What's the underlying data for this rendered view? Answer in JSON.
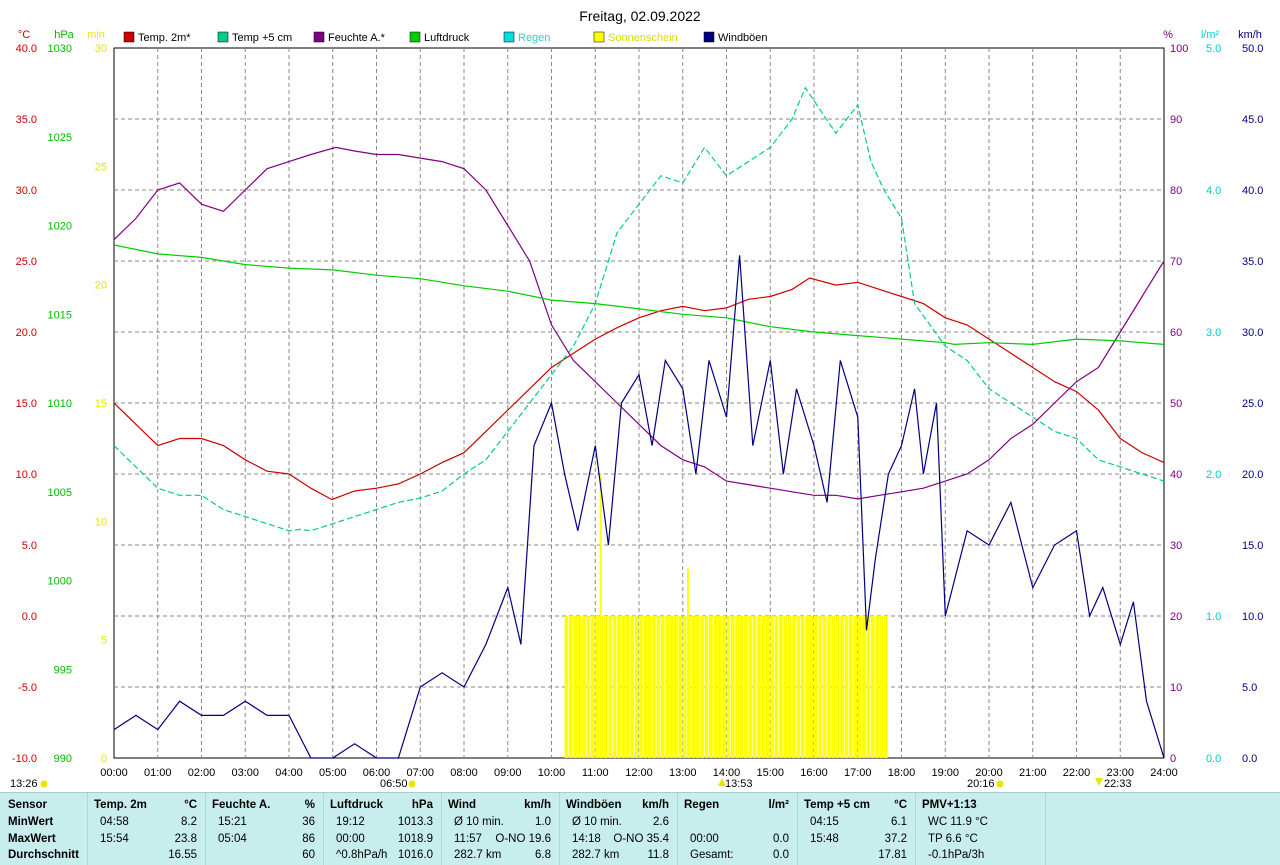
{
  "title": "Freitag, 02.09.2022",
  "axes": {
    "temp": {
      "unit": "°C",
      "color": "#cc0000",
      "ticks": [
        "40.0",
        "35.0",
        "30.0",
        "25.0",
        "20.0",
        "15.0",
        "10.0",
        "5.0",
        "0.0",
        "-5.0",
        "-10.0"
      ]
    },
    "pressure": {
      "unit": "hPa",
      "color": "#00bb00",
      "ticks": [
        "1030",
        "1025",
        "1020",
        "1015",
        "1010",
        "1005",
        "1000",
        "995",
        "990"
      ]
    },
    "minutes": {
      "unit": "min",
      "color": "#e6e600",
      "ticks": [
        "30",
        "25",
        "20",
        "15",
        "10",
        "5",
        "0"
      ]
    },
    "humidity": {
      "unit": "%",
      "color": "#800080",
      "ticks": [
        "100",
        "90",
        "80",
        "70",
        "60",
        "50",
        "40",
        "30",
        "20",
        "10",
        "0"
      ]
    },
    "rain": {
      "unit": "l/m²",
      "color": "#00cccc",
      "ticks": [
        "5.0",
        "4.0",
        "3.0",
        "2.0",
        "1.0",
        "0.0"
      ]
    },
    "wind": {
      "unit": "km/h",
      "color": "#000080",
      "ticks": [
        "50.0",
        "45.0",
        "40.0",
        "35.0",
        "30.0",
        "25.0",
        "20.0",
        "15.0",
        "10.0",
        "5.0",
        "0.0"
      ]
    }
  },
  "x_ticks": [
    "00:00",
    "01:00",
    "02:00",
    "03:00",
    "04:00",
    "05:00",
    "06:00",
    "07:00",
    "08:00",
    "09:00",
    "10:00",
    "11:00",
    "12:00",
    "13:00",
    "14:00",
    "15:00",
    "16:00",
    "17:00",
    "18:00",
    "19:00",
    "20:00",
    "21:00",
    "22:00",
    "23:00",
    "24:00"
  ],
  "legend": [
    {
      "label": "Temp. 2m*",
      "color": "#cc0000"
    },
    {
      "label": "Temp +5 cm",
      "color": "#00cc88"
    },
    {
      "label": "Feuchte A.*",
      "color": "#800080"
    },
    {
      "label": "Luftdruck",
      "color": "#00cc00"
    },
    {
      "label": "Regen",
      "color": "#00dddd"
    },
    {
      "label": "Sonnenschein",
      "color": "#ffff00"
    },
    {
      "label": "Windböen",
      "color": "#000080"
    }
  ],
  "markers": {
    "moonrise": "13:26",
    "sunrise": "06:50",
    "noon": "13:53",
    "sunset": "20:16",
    "moonset": "22:33"
  },
  "chart_data": {
    "type": "line",
    "x_unit": "hours",
    "series": [
      {
        "name": "Temp. 2m*",
        "axis": "temp",
        "color": "#cc0000",
        "points": [
          [
            0,
            15
          ],
          [
            0.5,
            13.5
          ],
          [
            1,
            12
          ],
          [
            1.5,
            12.5
          ],
          [
            2,
            12.5
          ],
          [
            2.5,
            12
          ],
          [
            3,
            11
          ],
          [
            3.5,
            10.2
          ],
          [
            4,
            10
          ],
          [
            4.5,
            9
          ],
          [
            4.98,
            8.2
          ],
          [
            5.5,
            8.8
          ],
          [
            6,
            9
          ],
          [
            6.5,
            9.3
          ],
          [
            7,
            10
          ],
          [
            7.5,
            10.8
          ],
          [
            8,
            11.5
          ],
          [
            8.5,
            13
          ],
          [
            9,
            14.5
          ],
          [
            9.5,
            16
          ],
          [
            10,
            17.5
          ],
          [
            10.5,
            18.5
          ],
          [
            11,
            19.5
          ],
          [
            11.5,
            20.3
          ],
          [
            12,
            21
          ],
          [
            12.5,
            21.5
          ],
          [
            13,
            21.8
          ],
          [
            13.5,
            21.5
          ],
          [
            14,
            21.7
          ],
          [
            14.5,
            22.3
          ],
          [
            15,
            22.5
          ],
          [
            15.5,
            23
          ],
          [
            15.9,
            23.8
          ],
          [
            16.5,
            23.3
          ],
          [
            17,
            23.5
          ],
          [
            17.5,
            23
          ],
          [
            18,
            22.5
          ],
          [
            18.5,
            22
          ],
          [
            19,
            21
          ],
          [
            19.5,
            20.5
          ],
          [
            20,
            19.5
          ],
          [
            20.5,
            18.5
          ],
          [
            21,
            17.5
          ],
          [
            21.5,
            16.5
          ],
          [
            22,
            15.8
          ],
          [
            22.5,
            14.5
          ],
          [
            23,
            12.5
          ],
          [
            23.5,
            11.5
          ],
          [
            24,
            10.8
          ]
        ]
      },
      {
        "name": "Temp +5 cm",
        "axis": "temp",
        "color": "#00cc88",
        "points": [
          [
            0,
            12
          ],
          [
            0.5,
            10.5
          ],
          [
            1,
            9
          ],
          [
            1.5,
            8.5
          ],
          [
            2,
            8.5
          ],
          [
            2.5,
            7.5
          ],
          [
            3,
            7
          ],
          [
            3.5,
            6.5
          ],
          [
            4,
            6
          ],
          [
            4.25,
            6.1
          ],
          [
            4.5,
            6
          ],
          [
            5,
            6.5
          ],
          [
            5.5,
            7
          ],
          [
            6,
            7.5
          ],
          [
            6.5,
            8
          ],
          [
            7,
            8.3
          ],
          [
            7.5,
            8.8
          ],
          [
            8,
            10
          ],
          [
            8.5,
            11
          ],
          [
            9,
            13
          ],
          [
            9.5,
            15
          ],
          [
            10,
            17
          ],
          [
            10.5,
            19
          ],
          [
            11,
            22
          ],
          [
            11.5,
            27
          ],
          [
            12,
            29
          ],
          [
            12.5,
            31
          ],
          [
            13,
            30.5
          ],
          [
            13.5,
            33
          ],
          [
            14,
            31
          ],
          [
            14.5,
            32
          ],
          [
            15,
            33
          ],
          [
            15.5,
            35
          ],
          [
            15.8,
            37.2
          ],
          [
            16.5,
            34
          ],
          [
            17,
            36
          ],
          [
            17.3,
            32
          ],
          [
            17.6,
            30
          ],
          [
            18,
            28
          ],
          [
            18.3,
            22
          ],
          [
            19,
            19
          ],
          [
            19.5,
            18
          ],
          [
            20,
            16
          ],
          [
            20.5,
            15
          ],
          [
            21,
            14
          ],
          [
            21.5,
            13
          ],
          [
            22,
            12.5
          ],
          [
            22.5,
            11
          ],
          [
            23,
            10.5
          ],
          [
            23.5,
            10
          ],
          [
            24,
            9.5
          ]
        ]
      },
      {
        "name": "Feuchte A.*",
        "axis": "humidity",
        "color": "#800080",
        "points": [
          [
            0,
            73
          ],
          [
            0.5,
            76
          ],
          [
            1,
            80
          ],
          [
            1.5,
            81
          ],
          [
            2,
            78
          ],
          [
            2.5,
            77
          ],
          [
            3,
            80
          ],
          [
            3.5,
            83
          ],
          [
            4,
            84
          ],
          [
            4.5,
            85
          ],
          [
            5.07,
            86
          ],
          [
            5.5,
            85.5
          ],
          [
            6,
            85
          ],
          [
            6.5,
            85
          ],
          [
            7,
            84.5
          ],
          [
            7.5,
            84
          ],
          [
            8,
            83
          ],
          [
            8.5,
            80
          ],
          [
            9,
            75
          ],
          [
            9.5,
            70
          ],
          [
            10,
            61
          ],
          [
            10.5,
            56
          ],
          [
            11,
            53
          ],
          [
            11.5,
            50
          ],
          [
            12,
            47
          ],
          [
            12.5,
            44
          ],
          [
            13,
            42
          ],
          [
            13.5,
            41
          ],
          [
            14,
            39
          ],
          [
            14.5,
            38.5
          ],
          [
            15,
            38
          ],
          [
            15.5,
            37.5
          ],
          [
            16,
            37
          ],
          [
            16.5,
            37
          ],
          [
            17,
            36.5
          ],
          [
            17.5,
            37
          ],
          [
            18,
            37.5
          ],
          [
            18.5,
            38
          ],
          [
            19,
            39
          ],
          [
            19.5,
            40
          ],
          [
            20,
            42
          ],
          [
            20.5,
            45
          ],
          [
            21,
            47
          ],
          [
            21.5,
            50
          ],
          [
            22,
            53
          ],
          [
            22.5,
            55
          ],
          [
            23,
            60
          ],
          [
            23.5,
            65
          ],
          [
            24,
            70
          ]
        ]
      },
      {
        "name": "Luftdruck",
        "axis": "pressure",
        "color": "#00cc00",
        "points": [
          [
            0,
            1018.9
          ],
          [
            1,
            1018.4
          ],
          [
            2,
            1018.2
          ],
          [
            3,
            1017.8
          ],
          [
            4,
            1017.6
          ],
          [
            5,
            1017.5
          ],
          [
            6,
            1017.2
          ],
          [
            7,
            1017
          ],
          [
            8,
            1016.6
          ],
          [
            9,
            1016.3
          ],
          [
            10,
            1015.8
          ],
          [
            11,
            1015.6
          ],
          [
            12,
            1015.3
          ],
          [
            13,
            1015
          ],
          [
            14,
            1014.8
          ],
          [
            15,
            1014.3
          ],
          [
            16,
            1014
          ],
          [
            17,
            1013.8
          ],
          [
            18,
            1013.6
          ],
          [
            19,
            1013.4
          ],
          [
            19.2,
            1013.3
          ],
          [
            20,
            1013.4
          ],
          [
            21,
            1013.3
          ],
          [
            22,
            1013.6
          ],
          [
            23,
            1013.5
          ],
          [
            24,
            1013.3
          ]
        ]
      },
      {
        "name": "Windböen",
        "axis": "wind",
        "color": "#000080",
        "points": [
          [
            0,
            2
          ],
          [
            0.5,
            3
          ],
          [
            1,
            2
          ],
          [
            1.5,
            4
          ],
          [
            2,
            3
          ],
          [
            2.5,
            3
          ],
          [
            3,
            4
          ],
          [
            3.5,
            3
          ],
          [
            4,
            3
          ],
          [
            4.5,
            0
          ],
          [
            5,
            0
          ],
          [
            5.5,
            1
          ],
          [
            6,
            0
          ],
          [
            6.5,
            0
          ],
          [
            7,
            5
          ],
          [
            7.5,
            6
          ],
          [
            8,
            5
          ],
          [
            8.5,
            8
          ],
          [
            9,
            12
          ],
          [
            9.3,
            8
          ],
          [
            9.6,
            22
          ],
          [
            10,
            25
          ],
          [
            10.3,
            20
          ],
          [
            10.6,
            16
          ],
          [
            11,
            22
          ],
          [
            11.3,
            15
          ],
          [
            11.6,
            25
          ],
          [
            12,
            27
          ],
          [
            12.3,
            22
          ],
          [
            12.6,
            28
          ],
          [
            13,
            26
          ],
          [
            13.3,
            20
          ],
          [
            13.6,
            28
          ],
          [
            14,
            24
          ],
          [
            14.3,
            35.4
          ],
          [
            14.6,
            22
          ],
          [
            15,
            28
          ],
          [
            15.3,
            20
          ],
          [
            15.6,
            26
          ],
          [
            16,
            22
          ],
          [
            16.3,
            18
          ],
          [
            16.6,
            28
          ],
          [
            17,
            24
          ],
          [
            17.2,
            9
          ],
          [
            17.4,
            14
          ],
          [
            17.7,
            20
          ],
          [
            18,
            22
          ],
          [
            18.3,
            26
          ],
          [
            18.5,
            20
          ],
          [
            18.8,
            25
          ],
          [
            19,
            10
          ],
          [
            19.5,
            16
          ],
          [
            20,
            15
          ],
          [
            20.5,
            18
          ],
          [
            21,
            12
          ],
          [
            21.5,
            15
          ],
          [
            22,
            16
          ],
          [
            22.3,
            10
          ],
          [
            22.6,
            12
          ],
          [
            23,
            8
          ],
          [
            23.3,
            11
          ],
          [
            23.6,
            4
          ],
          [
            24,
            0
          ]
        ]
      }
    ],
    "sunshine_bars": {
      "axis": "minutes",
      "color": "#ffff00",
      "start": 10.3,
      "end": 17.7,
      "level": 6,
      "spikes": [
        [
          11.1,
          12
        ],
        [
          13.1,
          8
        ]
      ]
    }
  },
  "stats": {
    "row_labels": [
      "Sensor",
      "MinWert",
      "MaxWert",
      "Durchschnitt"
    ],
    "columns": [
      {
        "header": "Temp. 2m",
        "unit": "°C",
        "rows": [
          [
            "04:58",
            "8.2"
          ],
          [
            "15:54",
            "23.8"
          ],
          [
            "",
            "16.55"
          ]
        ]
      },
      {
        "header": "Feuchte A.",
        "unit": "%",
        "rows": [
          [
            "15:21",
            "36"
          ],
          [
            "05:04",
            "86"
          ],
          [
            "",
            "60"
          ]
        ]
      },
      {
        "header": "Luftdruck",
        "unit": "hPa",
        "rows": [
          [
            "19:12",
            "1013.3"
          ],
          [
            "00:00",
            "1018.9"
          ],
          [
            "^0.8hPa/h",
            "1016.0"
          ]
        ]
      },
      {
        "header": "Wind",
        "unit": "km/h",
        "rows": [
          [
            "Ø 10 min.",
            "1.0"
          ],
          [
            "11:57",
            "O-NO 19.6"
          ],
          [
            "282.7 km",
            "6.8"
          ]
        ]
      },
      {
        "header": "Windböen",
        "unit": "km/h",
        "rows": [
          [
            "Ø 10 min.",
            "2.6"
          ],
          [
            "14:18",
            "O-NO 35.4"
          ],
          [
            "282.7 km",
            "11.8"
          ]
        ]
      },
      {
        "header": "Regen",
        "unit": "l/m²",
        "rows": [
          [
            "",
            ""
          ],
          [
            "00:00",
            "0.0"
          ],
          [
            "Gesamt:",
            "0.0"
          ]
        ]
      },
      {
        "header": "Temp +5 cm",
        "unit": "°C",
        "rows": [
          [
            "04:15",
            "6.1"
          ],
          [
            "15:48",
            "37.2"
          ],
          [
            "",
            "17.81"
          ]
        ]
      },
      {
        "header": "PMV+1:13",
        "unit": "",
        "rows": [
          [
            "WC 11.9 °C",
            ""
          ],
          [
            "TP 6.6 °C",
            ""
          ],
          [
            "-0.1hPa/3h",
            ""
          ]
        ]
      }
    ]
  }
}
